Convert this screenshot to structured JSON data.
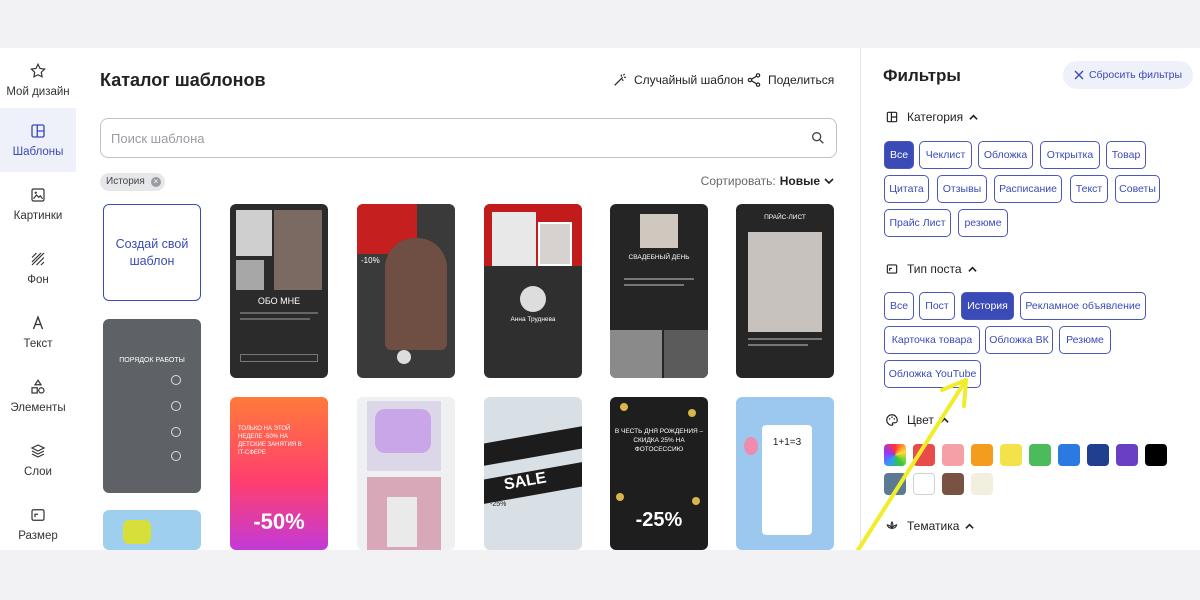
{
  "sidebar": {
    "items": [
      {
        "label": "Мой дизайн",
        "icon": "star-icon"
      },
      {
        "label": "Шаблоны",
        "icon": "templates-icon",
        "active": true
      },
      {
        "label": "Картинки",
        "icon": "image-icon"
      },
      {
        "label": "Фон",
        "icon": "background-icon"
      },
      {
        "label": "Текст",
        "icon": "text-icon"
      },
      {
        "label": "Элементы",
        "icon": "shapes-icon"
      },
      {
        "label": "Слои",
        "icon": "layers-icon"
      },
      {
        "label": "Размер",
        "icon": "resize-icon"
      }
    ]
  },
  "main": {
    "title": "Каталог шаблонов",
    "random_label": "Случайный шаблон",
    "share_label": "Поделиться",
    "search_placeholder": "Поиск шаблона",
    "active_chip": "История",
    "sort_label": "Сортировать:",
    "sort_value": "Новые",
    "create_label": "Создай свой шаблон"
  },
  "templates": {
    "t1": {
      "text": "ОБО МНЕ"
    },
    "t2": {
      "text": "-10%"
    },
    "t3": {
      "name": "Анна Труднева"
    },
    "t4": {
      "text": "СВАДЕБНЫЙ ДЕНЬ"
    },
    "t5": {
      "text": "ПРАЙС-ЛИСТ"
    },
    "t6": {
      "text": "ПОРЯДОК РАБОТЫ"
    },
    "t7": {
      "text": "ТОЛЬКО НА ЭТОЙ НЕДЕЛЕ -50% НА ДЕТСКИЕ ЗАНЯТИЯ В IT-СФЕРЕ",
      "big": "-50%"
    },
    "t8": {
      "text": "SALE",
      "pct": "-25%"
    },
    "t9": {
      "text": "В ЧЕСТЬ ДНЯ РОЖДЕНИЯ – СКИДКА 25% НА ФОТОСЕССИЮ",
      "big": "-25%"
    },
    "t10": {
      "text": "1+1=3"
    }
  },
  "filters": {
    "title": "Фильтры",
    "reset_label": "Сбросить фильтры",
    "category": {
      "label": "Категория",
      "options": [
        "Все",
        "Чеклист",
        "Обложка",
        "Открытка",
        "Товар",
        "Цитата",
        "Отзывы",
        "Расписание",
        "Текст",
        "Советы",
        "Прайс Лист",
        "резюме"
      ]
    },
    "post_type": {
      "label": "Тип поста",
      "options": [
        "Все",
        "Пост",
        "История",
        "Рекламное объявление",
        "Карточка товара",
        "Обложка ВК",
        "Резюме",
        "Обложка YouTube"
      ],
      "selected": "История"
    },
    "color": {
      "label": "Цвет",
      "swatches": [
        "#e94b4b",
        "#f4a0a6",
        "#f39c1e",
        "#f3e24a",
        "#4cbb5a",
        "#2a7ae2",
        "#1f3f8f",
        "#6a3fc4",
        "#000000",
        "#5b7a93",
        "#ffffff",
        "#7a5242",
        "#f2efe0"
      ]
    },
    "theme": {
      "label": "Тематика"
    }
  },
  "accent": "#3a4bb8",
  "arrow_color": "#f0ee2a"
}
